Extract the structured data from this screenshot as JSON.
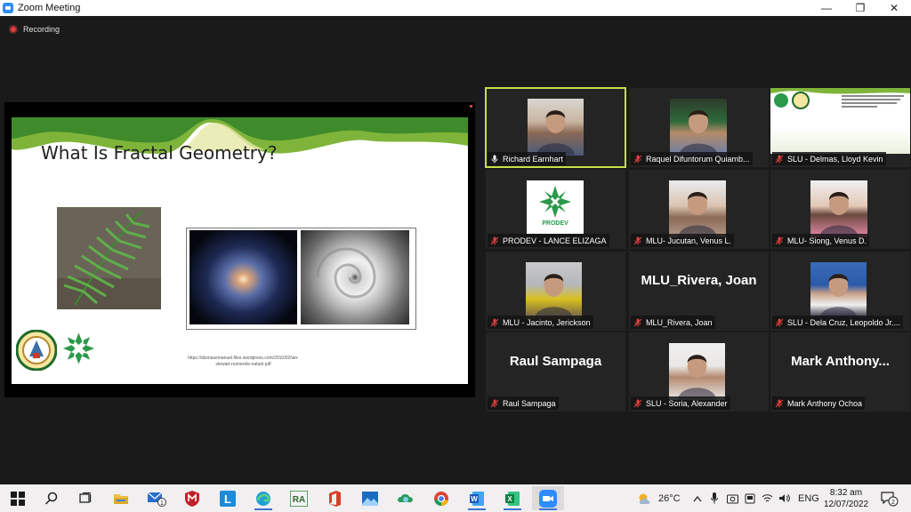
{
  "window": {
    "title": "Zoom Meeting",
    "minimize": "—",
    "maximize": "❐",
    "close": "✕"
  },
  "recording": {
    "label": "Recording"
  },
  "slide": {
    "title": "What Is Fractal Geometry?",
    "url_line1": "https://dismasemanuel.files.wordpress.com/2010/02/ian-",
    "url_line2": "stewart-numerele-naturii.pdf"
  },
  "participants": [
    {
      "name": "Richard Earnhart",
      "big": "",
      "mic": "active",
      "video": "photo",
      "active_speaker": true
    },
    {
      "name": "Raquel Difuntorum Quiamb...",
      "big": "",
      "mic": "muted",
      "video": "photo"
    },
    {
      "name": "SLU - Delmas, Lloyd Kevin",
      "big": "",
      "mic": "muted",
      "video": "screen"
    },
    {
      "name": "PRODEV - LANCE ELIZAGA",
      "big": "",
      "mic": "muted",
      "video": "logo",
      "logo_text": "PRODEV"
    },
    {
      "name": "MLU- Jucutan, Venus L.",
      "big": "",
      "mic": "muted",
      "video": "photo"
    },
    {
      "name": "MLU- Siong, Venus D.",
      "big": "",
      "mic": "muted",
      "video": "photo"
    },
    {
      "name": "MLU - Jacinto, Jerickson",
      "big": "",
      "mic": "muted",
      "video": "photo"
    },
    {
      "name": "MLU_Rivera, Joan",
      "big": "MLU_Rivera, Joan",
      "mic": "muted",
      "video": "none"
    },
    {
      "name": "SLU - Dela Cruz, Leopoldo Jr....",
      "big": "",
      "mic": "muted",
      "video": "photo"
    },
    {
      "name": "Raul Sampaga",
      "big": "Raul Sampaga",
      "mic": "muted",
      "video": "none"
    },
    {
      "name": "SLU - Soria, Alexander",
      "big": "",
      "mic": "muted",
      "video": "photo"
    },
    {
      "name": "Mark Anthony Ochoa",
      "big": "Mark  Anthony...",
      "mic": "muted",
      "video": "none"
    }
  ],
  "taskbar": {
    "apps": [
      "start-icon",
      "search-icon",
      "task-view-icon",
      "file-explorer-icon",
      "mail-icon",
      "mcafee-icon",
      "lms-icon",
      "edge-icon",
      "ra-icon",
      "office-icon",
      "photos-icon",
      "vpn-icon",
      "chrome-icon",
      "word-icon",
      "excel-icon",
      "zoom-icon"
    ],
    "mail_badge": "1",
    "ra_label": "RA",
    "lms_label": "L",
    "word_label": "W",
    "excel_label": "X",
    "temperature": "26°C",
    "language": "ENG",
    "time": "8:32 am",
    "date": "12/07/2022",
    "notifications": "2"
  },
  "colors": {
    "active_speaker": "#c9dd48",
    "muted_mic": "#e0403b",
    "taskbar": "#f1eff0",
    "zoom_blue": "#2d8cff"
  }
}
